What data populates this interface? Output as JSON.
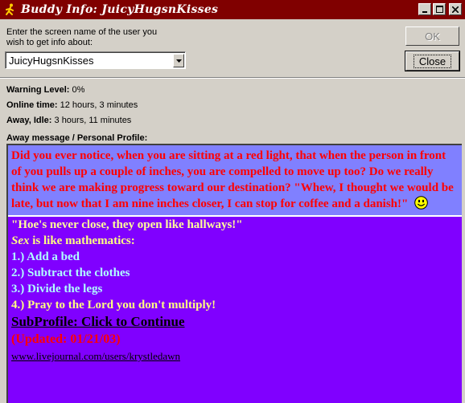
{
  "window": {
    "title": "Buddy Info: JuicyHugsnKisses",
    "titlebar_color": "#800000"
  },
  "lookup": {
    "prompt": "Enter the screen name of the user you wish to get info about:",
    "screen_name": "JuicyHugsnKisses"
  },
  "buttons": {
    "ok_label": "OK",
    "close_label": "Close"
  },
  "status": {
    "warning_label": "Warning Level:",
    "warning_value": "0%",
    "online_label": "Online time:",
    "online_value": "12 hours, 3 minutes",
    "idle_label": "Away, Idle:",
    "idle_value": "3 hours, 11 minutes"
  },
  "profile": {
    "section_label": "Away message / Personal Profile:",
    "away_message": "Did you ever notice, when you are sitting at a red light, that when the person in front of you pulls up a couple of inches, you are compelled to move up too? Do we really think we are making progress toward our destination? \"Whew, I thought we would be late, but now that I am nine inches closer, I can stop for coffee and a danish!\"",
    "quote": "\"Hoe's never close, they open like hallways!\"",
    "sex_word": "Sex",
    "sex_rest": " is like mathematics:",
    "list": [
      "1.) Add a bed",
      "2.) Subtract the clothes",
      "3.) Divide the legs"
    ],
    "last_line": "4.) Pray to the Lord you don't multiply!",
    "subprofile": "SubProfile: Click to Continue",
    "updated": "(Updated: 01/21/03)",
    "url": "www.livejournal.com/users/krystledawn",
    "colors": {
      "away_bg": "#8080ff",
      "away_text": "#ff0000",
      "profile_bg": "#8000ff"
    }
  }
}
